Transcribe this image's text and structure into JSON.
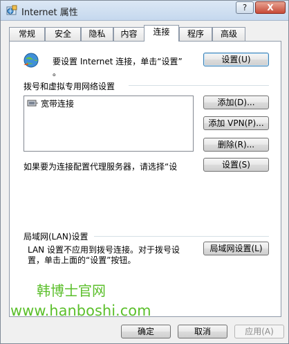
{
  "window": {
    "title": "Internet 属性",
    "help_label": "?",
    "close_label": "X"
  },
  "tabs": [
    {
      "label": "常规"
    },
    {
      "label": "安全"
    },
    {
      "label": "隐私"
    },
    {
      "label": "内容"
    },
    {
      "label": "连接",
      "active": true
    },
    {
      "label": "程序"
    },
    {
      "label": "高级"
    }
  ],
  "setup": {
    "text_line1": "要设置 Internet 连接，单击“设置”",
    "text_line2": "。",
    "button": "设置(U)"
  },
  "dialup": {
    "section_title": "拨号和虚拟专用网络设置",
    "connections": [
      "宽带连接"
    ],
    "add_button": "添加(D)...",
    "add_vpn_button": "添加 VPN(P)...",
    "delete_button": "删除(R)...",
    "proxy_text": "如果要为连接配置代理服务器，请选择“设",
    "settings_button": "设置(S)"
  },
  "lan": {
    "section_title": "局域网(LAN)设置",
    "text_line1": "LAN 设置不应用到拨号连接。对于拨号设",
    "text_line2": "置，单击上面的“设置”按钮。",
    "button": "局域网设置(L)"
  },
  "watermark": {
    "line1": "韩博士官网",
    "line2": "www.hanboshi.com"
  },
  "footer": {
    "ok": "确定",
    "cancel": "取消",
    "apply": "应用(A)"
  }
}
